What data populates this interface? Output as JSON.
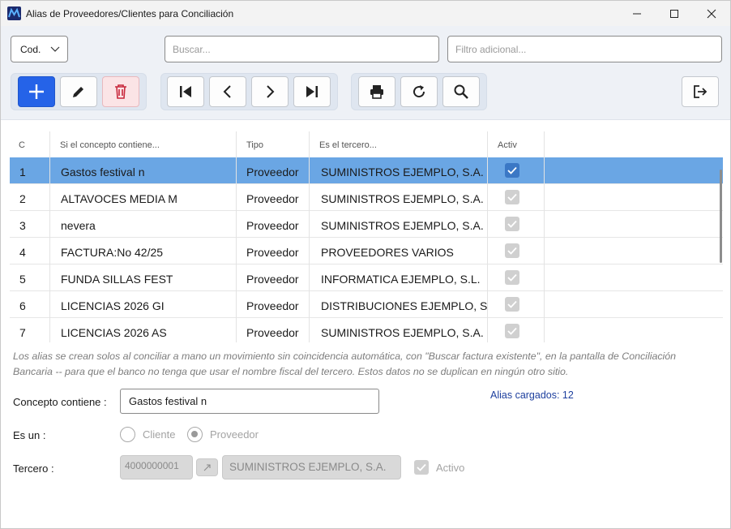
{
  "window": {
    "title": "Alias de Proveedores/Clientes para Conciliación"
  },
  "toolbar": {
    "sort_combo_value": "Cod.",
    "search_placeholder": "Buscar...",
    "filter_placeholder": "Filtro adicional...",
    "buttons": [
      "add-icon",
      "edit-icon",
      "delete-icon",
      "first-icon",
      "previous-icon",
      "next-icon",
      "last-icon",
      "print-icon",
      "refresh-icon",
      "search-icon",
      "exit-icon"
    ]
  },
  "table": {
    "headers": {
      "code": "C",
      "concept": "Si el concepto contiene...",
      "type": "Tipo",
      "third": "Es el tercero...",
      "active": "Activ"
    },
    "rows": [
      {
        "code": "1",
        "concept": "Gastos festival n",
        "type": "Proveedor",
        "third": "SUMINISTROS EJEMPLO, S.A.",
        "active": true
      },
      {
        "code": "2",
        "concept": "ALTAVOCES MEDIA M",
        "type": "Proveedor",
        "third": "SUMINISTROS EJEMPLO, S.A.",
        "active": true
      },
      {
        "code": "3",
        "concept": "nevera",
        "type": "Proveedor",
        "third": "SUMINISTROS EJEMPLO, S.A.",
        "active": true
      },
      {
        "code": "4",
        "concept": "FACTURA:No 42/25",
        "type": "Proveedor",
        "third": "PROVEEDORES VARIOS",
        "active": true
      },
      {
        "code": "5",
        "concept": "FUNDA SILLAS FEST",
        "type": "Proveedor",
        "third": "INFORMATICA EJEMPLO, S.L.",
        "active": true
      },
      {
        "code": "6",
        "concept": "LICENCIAS 2026 GI",
        "type": "Proveedor",
        "third": "DISTRIBUCIONES EJEMPLO, S.L.U.",
        "active": true
      },
      {
        "code": "7",
        "concept": "LICENCIAS 2026 AS",
        "type": "Proveedor",
        "third": "SUMINISTROS EJEMPLO, S.A.",
        "active": true
      }
    ]
  },
  "note": "Los alias se crean solos al conciliar a mano un movimiento sin coincidencia automática, con \"Buscar factura existente\", en la pantalla de Conciliación Bancaria -- para que el banco no tenga que usar el nombre fiscal del tercero. Estos datos no se duplican en ningún otro sitio.",
  "form": {
    "concept_label": "Concepto contiene :",
    "concept_value": "Gastos festival n",
    "alias_count": "Alias cargados: 12",
    "type_label": "Es un :",
    "client_label": "Cliente",
    "supplier_label": "Proveedor",
    "selected_type": "Proveedor",
    "third_label": "Tercero :",
    "third_code": "4000000001",
    "third_name": "SUMINISTROS EJEMPLO, S.A.",
    "active_label": "Activo",
    "active": true
  }
}
